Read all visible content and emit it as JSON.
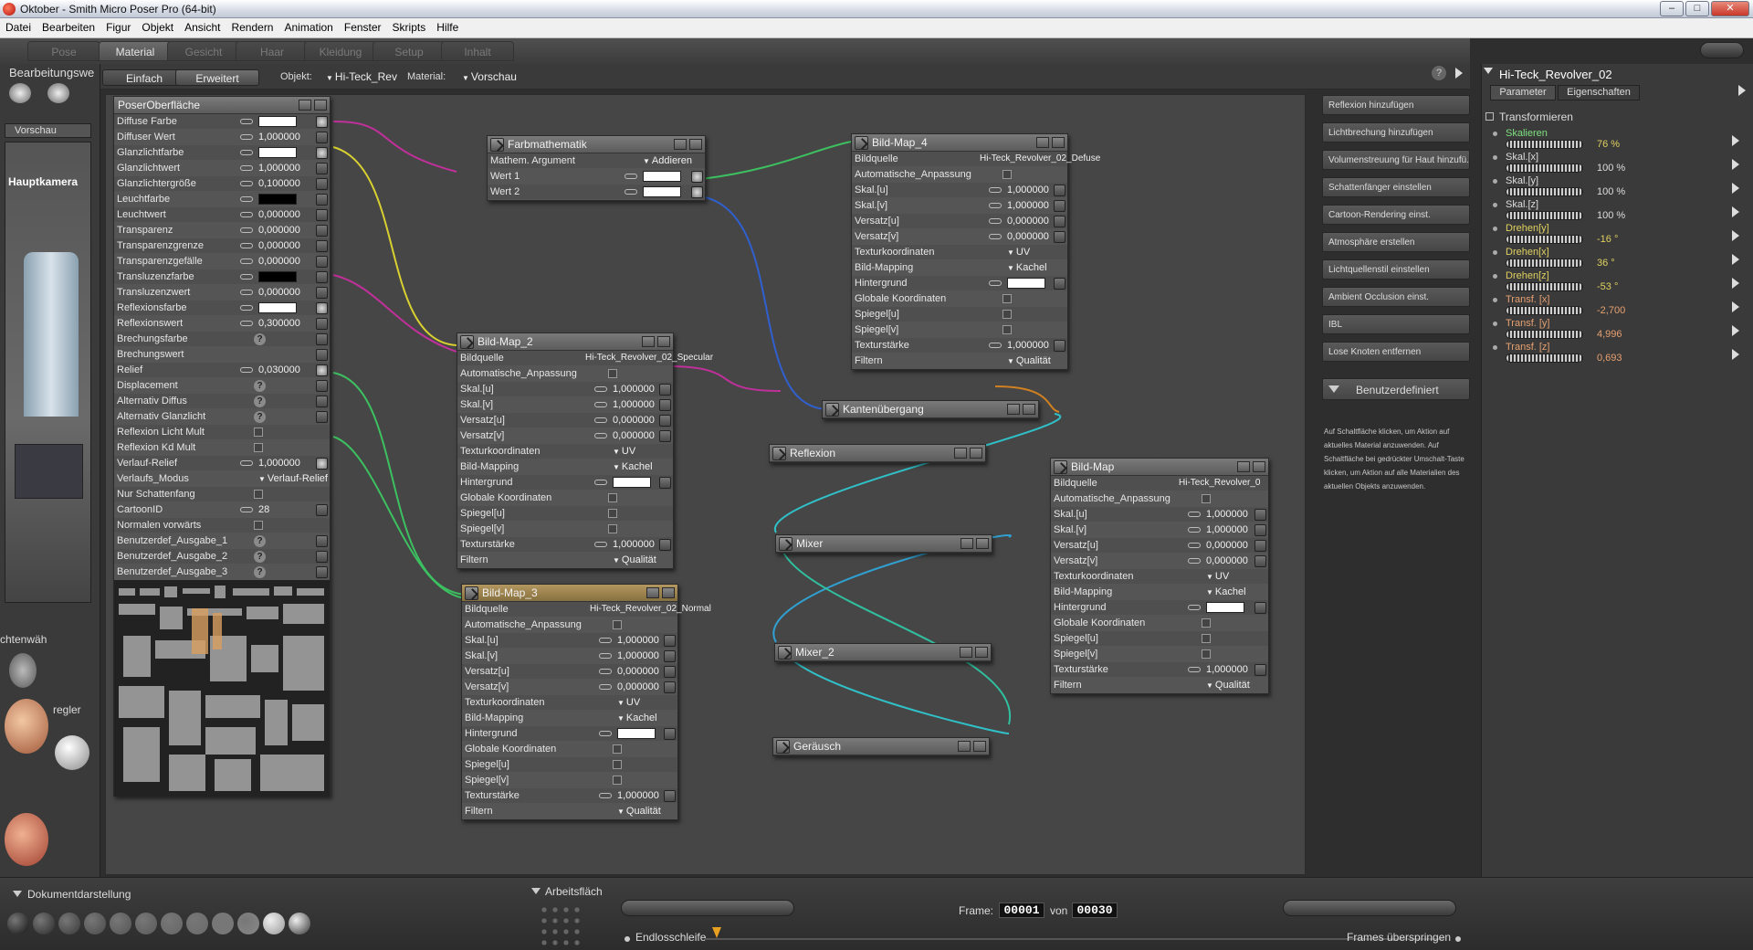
{
  "window": {
    "title": "Oktober - Smith Micro Poser Pro  (64-bit)",
    "minimize": "–",
    "maximize": "□",
    "close": "✕"
  },
  "menu": [
    "Datei",
    "Bearbeiten",
    "Figur",
    "Objekt",
    "Ansicht",
    "Rendern",
    "Animation",
    "Fenster",
    "Skripts",
    "Hilfe"
  ],
  "room_tabs": [
    "Pose",
    "Material",
    "Gesicht",
    "Haar",
    "Kleidung",
    "Setup",
    "Inhalt"
  ],
  "left": {
    "title": "Bearbeitungswe",
    "preview_tab": "Vorschau",
    "camera": "Hauptkamera",
    "lights": "chtenwäh",
    "regler": "regler"
  },
  "subtoolbar": {
    "simple": "Einfach",
    "advanced": "Erweitert",
    "object_label": "Objekt:",
    "object_value": "Hi-Teck_Rev",
    "material_label": "Material:",
    "material_value": "Vorschau",
    "help": "?"
  },
  "nodes": {
    "poser": {
      "title": "PoserOberfläche",
      "rows": [
        {
          "l": "Diffuse Farbe",
          "t": "swatch",
          "c": "#ffffff",
          "p": true
        },
        {
          "l": "Diffuser Wert",
          "t": "num",
          "v": "1,000000",
          "p": false
        },
        {
          "l": "Glanzlichtfarbe",
          "t": "swatch",
          "c": "#ffffff",
          "p": true
        },
        {
          "l": "Glanzlichtwert",
          "t": "num",
          "v": "1,000000",
          "p": false
        },
        {
          "l": "Glanzlichtergröße",
          "t": "num",
          "v": "0,100000",
          "p": false
        },
        {
          "l": "Leuchtfarbe",
          "t": "swatch",
          "c": "#000000",
          "p": false
        },
        {
          "l": "Leuchtwert",
          "t": "num",
          "v": "0,000000",
          "p": false
        },
        {
          "l": "Transparenz",
          "t": "num",
          "v": "0,000000",
          "p": false
        },
        {
          "l": "Transparenzgrenze",
          "t": "num",
          "v": "0,000000",
          "p": false
        },
        {
          "l": "Transparenzgefälle",
          "t": "num",
          "v": "0,000000",
          "p": false
        },
        {
          "l": "Transluzenzfarbe",
          "t": "swatch",
          "c": "#000000",
          "p": false
        },
        {
          "l": "Transluzenzwert",
          "t": "num",
          "v": "0,000000",
          "p": false
        },
        {
          "l": "Reflexionsfarbe",
          "t": "swatch",
          "c": "#ffffff",
          "p": true
        },
        {
          "l": "Reflexionswert",
          "t": "num",
          "v": "0,300000",
          "p": false
        },
        {
          "l": "Brechungsfarbe",
          "t": "q",
          "p": false
        },
        {
          "l": "Brechungswert",
          "t": "none",
          "p": false
        },
        {
          "l": "Relief",
          "t": "num",
          "v": "0,030000",
          "p": true
        },
        {
          "l": "Displacement",
          "t": "q",
          "p": false
        },
        {
          "l": "Alternativ Diffus",
          "t": "q",
          "p": false
        },
        {
          "l": "Alternativ Glanzlicht",
          "t": "q",
          "p": false
        },
        {
          "l": "Reflexion Licht Mult",
          "t": "chk",
          "p": false
        },
        {
          "l": "Reflexion Kd Mult",
          "t": "chk",
          "p": false
        },
        {
          "l": "Verlauf-Relief",
          "t": "num",
          "v": "1,000000",
          "p": true
        },
        {
          "l": "Verlaufs_Modus",
          "t": "dd",
          "v": "Verlauf-Relief",
          "p": false
        },
        {
          "l": "Nur Schattenfang",
          "t": "chk",
          "p": false
        },
        {
          "l": "CartoonID",
          "t": "num",
          "v": "28",
          "p": false
        },
        {
          "l": "Normalen vorwärts",
          "t": "chk",
          "p": false
        },
        {
          "l": "Benutzerdef_Ausgabe_1",
          "t": "q",
          "p": false
        },
        {
          "l": "Benutzerdef_Ausgabe_2",
          "t": "q",
          "p": false
        },
        {
          "l": "Benutzerdef_Ausgabe_3",
          "t": "q",
          "p": false
        }
      ]
    },
    "farbmath": {
      "title": "Farbmathematik",
      "rows": [
        {
          "l": "Mathem. Argument",
          "t": "dd",
          "v": "Addieren"
        },
        {
          "l": "Wert 1",
          "t": "swatch",
          "c": "#ffffff",
          "p": true
        },
        {
          "l": "Wert 2",
          "t": "swatch",
          "c": "#ffffff",
          "p": true
        }
      ]
    },
    "bildmap4": {
      "title": "Bild-Map_4",
      "rows": [
        {
          "l": "Bildquelle",
          "t": "text",
          "v": "Hi-Teck_Revolver_02_Defuse"
        },
        {
          "l": "Automatische_Anpassung",
          "t": "chk"
        },
        {
          "l": "Skal.[u]",
          "t": "num",
          "v": "1,000000"
        },
        {
          "l": "Skal.[v]",
          "t": "num",
          "v": "1,000000"
        },
        {
          "l": "Versatz[u]",
          "t": "num",
          "v": "0,000000"
        },
        {
          "l": "Versatz[v]",
          "t": "num",
          "v": "0,000000"
        },
        {
          "l": "Texturkoordinaten",
          "t": "dd",
          "v": "UV"
        },
        {
          "l": "Bild-Mapping",
          "t": "dd",
          "v": "Kachel"
        },
        {
          "l": "Hintergrund",
          "t": "swatch",
          "c": "#ffffff"
        },
        {
          "l": "Globale Koordinaten",
          "t": "chk"
        },
        {
          "l": "Spiegel[u]",
          "t": "chk"
        },
        {
          "l": "Spiegel[v]",
          "t": "chk"
        },
        {
          "l": "Texturstärke",
          "t": "num",
          "v": "1,000000"
        },
        {
          "l": "Filtern",
          "t": "dd",
          "v": "Qualität"
        }
      ]
    },
    "bildmap2": {
      "title": "Bild-Map_2",
      "rows": [
        {
          "l": "Bildquelle",
          "t": "text",
          "v": "Hi-Teck_Revolver_02_Specular"
        },
        {
          "l": "Automatische_Anpassung",
          "t": "chk"
        },
        {
          "l": "Skal.[u]",
          "t": "num",
          "v": "1,000000"
        },
        {
          "l": "Skal.[v]",
          "t": "num",
          "v": "1,000000"
        },
        {
          "l": "Versatz[u]",
          "t": "num",
          "v": "0,000000"
        },
        {
          "l": "Versatz[v]",
          "t": "num",
          "v": "0,000000"
        },
        {
          "l": "Texturkoordinaten",
          "t": "dd",
          "v": "UV"
        },
        {
          "l": "Bild-Mapping",
          "t": "dd",
          "v": "Kachel"
        },
        {
          "l": "Hintergrund",
          "t": "swatch",
          "c": "#ffffff"
        },
        {
          "l": "Globale Koordinaten",
          "t": "chk"
        },
        {
          "l": "Spiegel[u]",
          "t": "chk"
        },
        {
          "l": "Spiegel[v]",
          "t": "chk"
        },
        {
          "l": "Texturstärke",
          "t": "num",
          "v": "1,000000"
        },
        {
          "l": "Filtern",
          "t": "dd",
          "v": "Qualität"
        }
      ]
    },
    "bildmap3": {
      "title": "Bild-Map_3",
      "rows": [
        {
          "l": "Bildquelle",
          "t": "text",
          "v": "Hi-Teck_Revolver_02_Normal"
        },
        {
          "l": "Automatische_Anpassung",
          "t": "chk"
        },
        {
          "l": "Skal.[u]",
          "t": "num",
          "v": "1,000000"
        },
        {
          "l": "Skal.[v]",
          "t": "num",
          "v": "1,000000"
        },
        {
          "l": "Versatz[u]",
          "t": "num",
          "v": "0,000000"
        },
        {
          "l": "Versatz[v]",
          "t": "num",
          "v": "0,000000"
        },
        {
          "l": "Texturkoordinaten",
          "t": "dd",
          "v": "UV"
        },
        {
          "l": "Bild-Mapping",
          "t": "dd",
          "v": "Kachel"
        },
        {
          "l": "Hintergrund",
          "t": "swatch",
          "c": "#ffffff"
        },
        {
          "l": "Globale Koordinaten",
          "t": "chk"
        },
        {
          "l": "Spiegel[u]",
          "t": "chk"
        },
        {
          "l": "Spiegel[v]",
          "t": "chk"
        },
        {
          "l": "Texturstärke",
          "t": "num",
          "v": "1,000000"
        },
        {
          "l": "Filtern",
          "t": "dd",
          "v": "Qualität"
        }
      ]
    },
    "bildmap": {
      "title": "Bild-Map",
      "rows": [
        {
          "l": "Bildquelle",
          "t": "text",
          "v": "Hi-Teck_Revolver_0"
        },
        {
          "l": "Automatische_Anpassung",
          "t": "chk"
        },
        {
          "l": "Skal.[u]",
          "t": "num",
          "v": "1,000000"
        },
        {
          "l": "Skal.[v]",
          "t": "num",
          "v": "1,000000"
        },
        {
          "l": "Versatz[u]",
          "t": "num",
          "v": "0,000000"
        },
        {
          "l": "Versatz[v]",
          "t": "num",
          "v": "0,000000"
        },
        {
          "l": "Texturkoordinaten",
          "t": "dd",
          "v": "UV"
        },
        {
          "l": "Bild-Mapping",
          "t": "dd",
          "v": "Kachel"
        },
        {
          "l": "Hintergrund",
          "t": "swatch",
          "c": "#ffffff"
        },
        {
          "l": "Globale Koordinaten",
          "t": "chk"
        },
        {
          "l": "Spiegel[u]",
          "t": "chk"
        },
        {
          "l": "Spiegel[v]",
          "t": "chk"
        },
        {
          "l": "Texturstärke",
          "t": "num",
          "v": "1,000000"
        },
        {
          "l": "Filtern",
          "t": "dd",
          "v": "Qualität"
        }
      ]
    },
    "kanten": {
      "title": "Kantenübergang"
    },
    "reflexion": {
      "title": "Reflexion"
    },
    "mixer": {
      "title": "Mixer"
    },
    "mixer2": {
      "title": "Mixer_2"
    },
    "geraeusch": {
      "title": "Geräusch"
    }
  },
  "actions": [
    "Reflexion hinzufügen",
    "Lichtbrechung hinzufügen",
    "Volumenstreuung für Haut hinzufü...",
    "Schattenfänger einstellen",
    "Cartoon-Rendering einst.",
    "Atmosphäre erstellen",
    "Lichtquellenstil einstellen",
    "Ambient Occlusion einst.",
    "IBL",
    "Lose Knoten entfernen"
  ],
  "custom_button": "Benutzerdefiniert",
  "help_text": "Auf Schaltfläche klicken, um Aktion auf aktuelles Material anzuwenden. Auf Schaltfläche bei gedrückter Umschalt-Taste klicken, um Aktion auf alle Materialien des aktuellen Objekts anzuwenden.",
  "right_panel": {
    "title": "Hi-Teck_Revolver_02",
    "tab_params": "Parameter",
    "tab_props": "Eigenschaften",
    "group": "Transformieren",
    "params": [
      {
        "label": "Skalieren",
        "value": "76 %",
        "color": "yellow",
        "highlight": true
      },
      {
        "label": "Skal.[x]",
        "value": "100 %",
        "color": "white"
      },
      {
        "label": "Skal.[y]",
        "value": "100 %",
        "color": "white"
      },
      {
        "label": "Skal.[z]",
        "value": "100 %",
        "color": "white"
      },
      {
        "label": "Drehen[y]",
        "value": "-16 °",
        "color": "yellow"
      },
      {
        "label": "Drehen[x]",
        "value": "36 °",
        "color": "yellow"
      },
      {
        "label": "Drehen[z]",
        "value": "-53 °",
        "color": "yellow"
      },
      {
        "label": "Transf. [x]",
        "value": "-2,700",
        "color": "orange"
      },
      {
        "label": "Transf. [y]",
        "value": "4,996",
        "color": "orange"
      },
      {
        "label": "Transf. [z]",
        "value": "0,693",
        "color": "orange"
      }
    ]
  },
  "bottom": {
    "doc_display": "Dokumentdarstellung",
    "workspace": "Arbeitsfläch",
    "frame_label": "Frame:",
    "frame_value": "00001",
    "of_label": "von",
    "frame_total": "00030",
    "loop": "Endlosschleife",
    "skip": "Frames überspringen"
  },
  "colors": {
    "accent": "#b49760",
    "wire_magenta": "#c0309a",
    "wire_yellow": "#d8d030",
    "wire_green": "#3cc060",
    "wire_blue": "#3060d0",
    "wire_cyan": "#30c0c8",
    "wire_orange": "#d08020"
  }
}
